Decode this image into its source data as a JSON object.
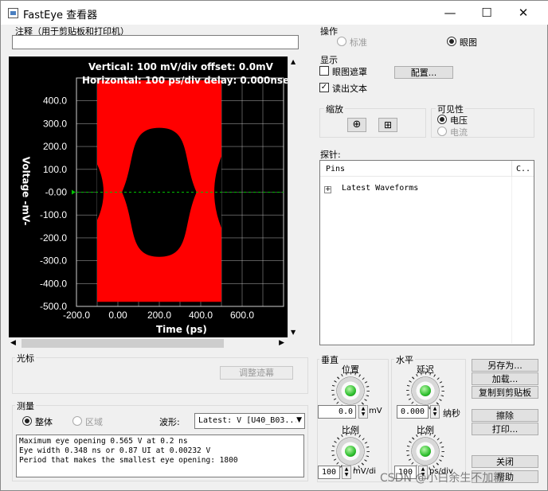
{
  "window": {
    "title": "FastEye 查看器",
    "minimize": "—",
    "maximize": "☐",
    "close": "✕"
  },
  "annotation": {
    "label": "注释（用于剪贴板和打印机）",
    "value": ""
  },
  "plot": {
    "header_vertical": "Vertical: 100 mV/div  offset: 0.0mV",
    "header_horizontal": "Horizontal: 100 ps/div  delay: 0.000nsec",
    "xlabel": "Time (ps)",
    "ylabel": "Voltage -mV-",
    "marker_label": "-0.00",
    "colors": {
      "eye": "#ff0000",
      "background": "#000000",
      "grid": "#d0d0d0",
      "zero_line": "#00c000"
    }
  },
  "chart_data": {
    "type": "area",
    "x_ticks": [
      "-200.0",
      "0.00",
      "200.0",
      "400.0",
      "600.0"
    ],
    "y_ticks": [
      "400.0",
      "300.0",
      "200.0",
      "100.0",
      "-0.00",
      "-100.0",
      "-200.0",
      "-300.0",
      "-400.0",
      "-500.0"
    ],
    "xlim": [
      -200,
      800
    ],
    "ylim": [
      -500,
      500
    ],
    "grid": true,
    "series": [
      {
        "x": [
          -100,
          500
        ],
        "y_top": [
          490,
          490
        ],
        "y_bottom": [
          -480,
          -480
        ]
      }
    ],
    "eye_opening": {
      "x_left": 20,
      "x_right": 380,
      "center_x": 200,
      "top": 282,
      "bottom": -283
    }
  },
  "cursor": {
    "label": "光标",
    "adjust_button": "调整迹幕"
  },
  "measure": {
    "label": "测量",
    "whole": "整体",
    "region": "区域",
    "waveform_label": "波形:",
    "waveform_value": "Latest: V [U40_B03...",
    "output": [
      "Maximum eye opening 0.565 V at 0.2 ns",
      "Eye width 0.348 ns or 0.87 UI at 0.00232 V",
      "Period that makes the smallest eye opening: 1800"
    ]
  },
  "operation": {
    "label": "操作",
    "standard": "标准",
    "eye": "眼图"
  },
  "display": {
    "label": "显示",
    "eye_mask": "眼图遮罩",
    "read_text": "读出文本",
    "config_button": "配置..."
  },
  "zoom": {
    "label": "缩放"
  },
  "visibility": {
    "label": "可见性",
    "voltage": "电压",
    "current": "电流"
  },
  "probe": {
    "label": "探针:",
    "col_pins": "Pins",
    "col_c": "C..",
    "tree_item": "Latest Waveforms",
    "expand": "+"
  },
  "vertical": {
    "label": "垂直",
    "position": "位置",
    "position_value": "0.0",
    "position_unit": "mV",
    "scale": "比例",
    "scale_value": "100",
    "scale_unit": "mV/di"
  },
  "horizontal": {
    "label": "水平",
    "delay": "延迟",
    "delay_value": "0.000",
    "delay_unit": "纳秒",
    "scale": "比例",
    "scale_value": "100",
    "scale_unit": "ps/div"
  },
  "actions": {
    "save_as": "另存为...",
    "load": "加载...",
    "copy_clipboard": "复制到剪贴板",
    "erase": "擦除",
    "print": "打印...",
    "close": "关闭",
    "help": "帮助"
  },
  "watermark": "CSDN @小白余生不加糖"
}
